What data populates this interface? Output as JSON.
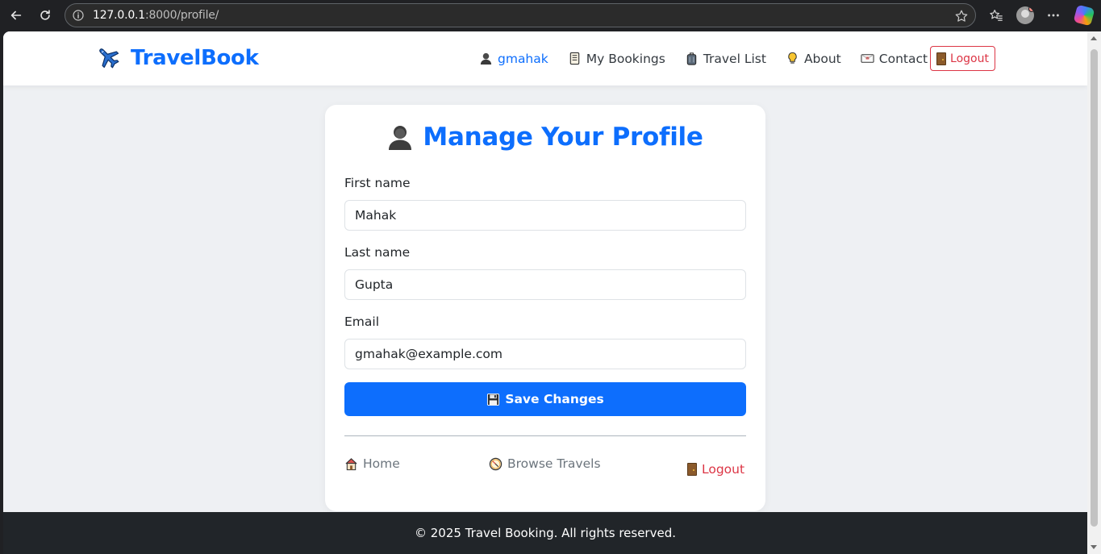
{
  "browser": {
    "url_host": "127.0.0.1",
    "url_path": ":8000/profile/"
  },
  "navbar": {
    "brand": "TravelBook",
    "links": [
      {
        "label": "gmahak",
        "icon": "person-icon"
      },
      {
        "label": "My Bookings",
        "icon": "scroll-icon"
      },
      {
        "label": "Travel List",
        "icon": "luggage-icon"
      },
      {
        "label": "About",
        "icon": "bulb-icon"
      },
      {
        "label": "Contact",
        "icon": "envelope-icon"
      }
    ],
    "logout_label": "Logout"
  },
  "profile": {
    "title": "Manage Your Profile",
    "fields": [
      {
        "label": "First name",
        "value": "Mahak"
      },
      {
        "label": "Last name",
        "value": "Gupta"
      },
      {
        "label": "Email",
        "value": "gmahak@example.com"
      }
    ],
    "save_label": "Save Changes",
    "links": {
      "home": "Home",
      "browse": "Browse Travels",
      "logout": "Logout"
    }
  },
  "footer": {
    "text": "© 2025 Travel Booking. All rights reserved."
  },
  "colors": {
    "primary": "#0d6efd",
    "danger": "#dc3545",
    "footer_bg": "#212529",
    "page_bg": "#eef0f3"
  }
}
